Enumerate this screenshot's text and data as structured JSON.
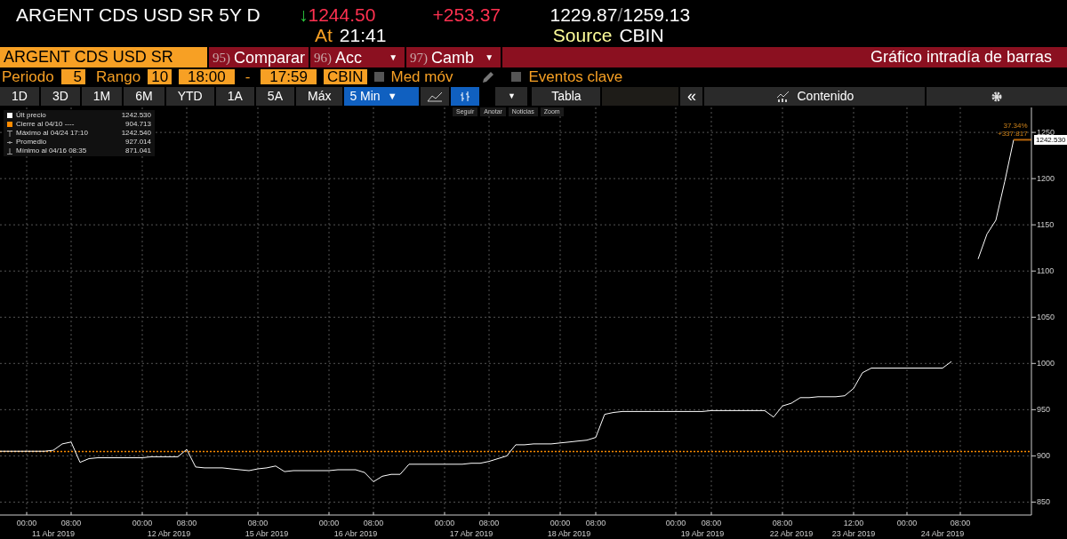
{
  "quote": {
    "name": "ARGENT CDS USD SR 5Y D",
    "arrow": "↓",
    "last": "1244.50",
    "change": "+253.37",
    "low": "1229.87",
    "separator": "/",
    "high": "1259.13",
    "at_label": "At",
    "time": "21:41",
    "source_label": "Source",
    "source": "CBIN"
  },
  "menu_bar": {
    "security": "ARGENT CDS USD SR",
    "actions": [
      {
        "number": "95)",
        "label": "Comparar"
      },
      {
        "number": "96)",
        "label": "Acc",
        "caret": "▼"
      },
      {
        "number": "97)",
        "label": "Camb",
        "caret": "▼"
      }
    ],
    "title": "Gráfico intradía de barras"
  },
  "settings": {
    "period_label": "Periodo",
    "period": "5",
    "range_label": "Rango",
    "range": "10",
    "start": "18:00",
    "dash": "-",
    "end": "17:59",
    "source": "CBIN",
    "moving_average": {
      "label": "Med móv",
      "checked": false
    },
    "key_events": {
      "label": "Eventos clave",
      "checked": false
    }
  },
  "toolbar": {
    "ranges": [
      {
        "label": "1D",
        "selected": false
      },
      {
        "label": "3D",
        "selected": false
      },
      {
        "label": "1M",
        "selected": false
      },
      {
        "label": "6M",
        "selected": false
      },
      {
        "label": "YTD",
        "selected": false
      },
      {
        "label": "1A",
        "selected": false
      },
      {
        "label": "5A",
        "selected": false
      },
      {
        "label": "Máx",
        "selected": false
      }
    ],
    "interval": {
      "label": "5 Min",
      "caret": "▼",
      "selected": true
    },
    "chart_types": [
      {
        "kind": "line",
        "selected": false
      },
      {
        "kind": "bar",
        "selected": true
      }
    ],
    "more": "▼",
    "table": "Tabla",
    "collapse": "«",
    "contents": "Contenido"
  },
  "chart_tools": [
    "Seguir",
    "Anotar",
    "Noticias",
    "Zoom"
  ],
  "legend": [
    {
      "kind": "last",
      "label": "Últ precio",
      "value": "1242.530",
      "color": "#ffffff"
    },
    {
      "kind": "close",
      "label": "Cierre al 04/10 ----",
      "value": "904.713",
      "color": "#ff8c00"
    },
    {
      "kind": "max",
      "label": "Máximo al 04/24 17:10",
      "value": "1242.540"
    },
    {
      "kind": "avg",
      "label": "Promedio",
      "value": "927.014"
    },
    {
      "kind": "min",
      "label": "Mínimo al 04/16 08:35",
      "value": "871.041"
    }
  ],
  "last_tag": "1242.530",
  "change_note": [
    "37.34%",
    "+337.817"
  ],
  "date_row": {
    "6": "11 Abr 2019",
    "19": "12 Abr 2019",
    "30": "15 Abr 2019",
    "40": "16 Abr 2019",
    "53": "17 Abr 2019",
    "64": "18 Abr 2019",
    "79": "19 Abr 2019",
    "89": "22 Abr 2019",
    "96": "23 Abr 2019",
    "106": "24 Abr 2019"
  },
  "chart_data": {
    "type": "line",
    "grid": true,
    "ylim": [
      836,
      1277
    ],
    "yticks": [
      850,
      900,
      950,
      1000,
      1050,
      1100,
      1150,
      1200,
      1250
    ],
    "ref_lines": [
      {
        "axis": "y",
        "value": 904.713,
        "color": "#ff8c00"
      }
    ],
    "categories": [
      null,
      null,
      null,
      "00:00",
      null,
      null,
      null,
      null,
      "08:00",
      null,
      null,
      null,
      null,
      null,
      null,
      null,
      "00:00",
      null,
      null,
      null,
      null,
      "08:00",
      null,
      null,
      null,
      null,
      null,
      null,
      null,
      "08:00",
      null,
      null,
      null,
      null,
      null,
      null,
      null,
      "00:00",
      null,
      null,
      null,
      null,
      "08:00",
      null,
      null,
      null,
      null,
      null,
      null,
      null,
      "00:00",
      null,
      null,
      null,
      null,
      "08:00",
      null,
      null,
      null,
      null,
      null,
      null,
      null,
      "00:00",
      null,
      null,
      null,
      "08:00",
      null,
      null,
      null,
      null,
      null,
      null,
      null,
      null,
      "00:00",
      null,
      null,
      null,
      "08:00",
      null,
      null,
      null,
      null,
      null,
      null,
      null,
      "08:00",
      null,
      null,
      null,
      null,
      null,
      null,
      null,
      "12:00",
      null,
      null,
      null,
      null,
      null,
      "00:00",
      null,
      null,
      null,
      null,
      null,
      "08:00",
      null,
      null,
      null,
      null,
      null,
      null,
      null,
      null
    ],
    "series": [
      {
        "color": "#ffffff",
        "values": [
          905,
          905,
          905,
          905,
          905,
          905,
          906,
          913,
          915,
          893,
          897,
          898,
          898,
          898,
          898,
          898,
          898,
          899,
          899,
          899,
          899,
          907,
          888,
          887,
          887,
          887,
          886,
          885,
          884,
          886,
          887,
          889,
          883,
          884,
          884,
          884,
          884,
          884,
          885,
          885,
          885,
          882,
          872,
          878,
          880,
          880,
          891,
          891,
          891,
          891,
          891,
          891,
          891,
          892,
          892,
          894,
          897,
          900,
          912,
          912,
          913,
          913,
          913,
          914,
          915,
          916,
          917,
          920,
          945,
          947,
          948,
          948,
          948,
          948,
          948,
          948,
          948,
          948,
          948,
          948,
          949,
          949,
          949,
          949,
          949,
          949,
          949,
          942,
          954,
          957,
          963,
          963,
          964,
          964,
          964,
          965,
          973,
          990,
          995,
          995,
          995,
          995,
          995,
          995,
          995,
          995,
          995,
          1002,
          null,
          null,
          1113,
          1140,
          1155,
          1197,
          1242,
          null,
          null
        ]
      }
    ]
  }
}
